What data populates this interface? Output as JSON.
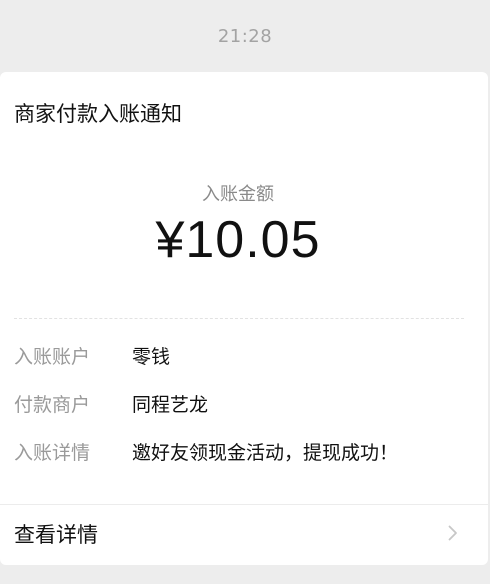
{
  "timestamp": "21:28",
  "card": {
    "title": "商家付款入账通知",
    "amount_label": "入账金额",
    "amount_value": "¥10.05",
    "rows": [
      {
        "label": "入账账户",
        "value": "零钱"
      },
      {
        "label": "付款商户",
        "value": "同程艺龙"
      },
      {
        "label": "入账详情",
        "value": "邀好友领现金活动，提现成功！"
      }
    ],
    "details_link": "查看详情",
    "chevron_icon": "chevron-right-icon"
  },
  "colors": {
    "background": "#ededed",
    "card": "#ffffff",
    "primary_text": "#111111",
    "secondary_text": "#9a9a9a",
    "chevron": "#c7c7c7"
  }
}
